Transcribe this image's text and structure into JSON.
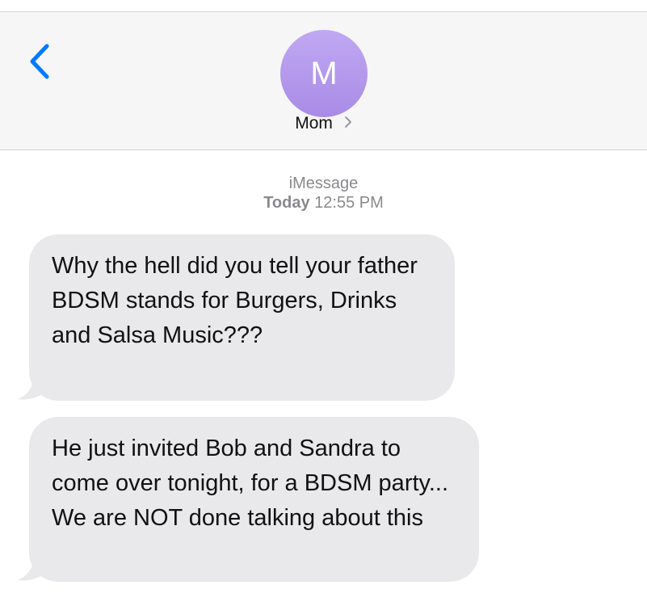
{
  "header": {
    "avatar_letter": "M",
    "contact_name": "Mom",
    "back_icon": "chevron-left-icon",
    "accent_color": "#007aff",
    "avatar_color": "#b69cf0"
  },
  "conversation": {
    "service": "iMessage",
    "day": "Today",
    "time": "12:55 PM",
    "messages": [
      {
        "direction": "incoming",
        "text": "Why the hell did you tell your father BDSM stands for Burgers, Drinks and Salsa Music???"
      },
      {
        "direction": "incoming",
        "text": "He just invited Bob and Sandra to come over tonight, for a BDSM party... We are NOT done talking about this"
      }
    ]
  }
}
